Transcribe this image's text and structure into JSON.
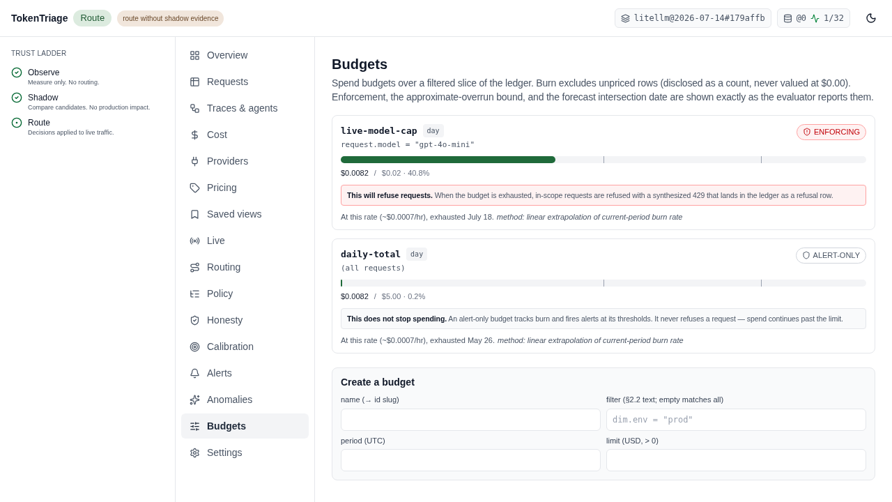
{
  "header": {
    "brand": "TokenTriage",
    "mode_badge": "Route",
    "warning_badge": "route without shadow evidence",
    "snapshot": "litellm@2026-07-14#179affb",
    "db_count": "@0",
    "activity": "1/32"
  },
  "trust_ladder": {
    "title": "TRUST LADDER",
    "steps": [
      {
        "name": "Observe",
        "description": "Measure only. No routing.",
        "kind": "done"
      },
      {
        "name": "Shadow",
        "description": "Compare candidates. No production impact.",
        "kind": "done"
      },
      {
        "name": "Route",
        "description": "Decisions applied to live traffic.",
        "kind": "current"
      }
    ]
  },
  "nav": [
    {
      "label": "Overview",
      "selected": false
    },
    {
      "label": "Requests",
      "selected": false
    },
    {
      "label": "Traces & agents",
      "selected": false
    },
    {
      "label": "Cost",
      "selected": false
    },
    {
      "label": "Providers",
      "selected": false
    },
    {
      "label": "Pricing",
      "selected": false
    },
    {
      "label": "Saved views",
      "selected": false
    },
    {
      "label": "Live",
      "selected": false
    },
    {
      "label": "Routing",
      "selected": false
    },
    {
      "label": "Policy",
      "selected": false
    },
    {
      "label": "Honesty",
      "selected": false
    },
    {
      "label": "Calibration",
      "selected": false
    },
    {
      "label": "Alerts",
      "selected": false
    },
    {
      "label": "Anomalies",
      "selected": false
    },
    {
      "label": "Budgets",
      "selected": true
    },
    {
      "label": "Settings",
      "selected": false
    }
  ],
  "page": {
    "title": "Budgets",
    "description": "Spend budgets over a filtered slice of the ledger. Burn excludes unpriced rows (disclosed as a count, never valued at $0.00). Enforcement, the approximate-overrun bound, and the forecast intersection date are shown exactly as the evaluator reports them."
  },
  "budgets": [
    {
      "name": "live-model-cap",
      "period": "day",
      "filter": "request.model = \"gpt-4o-mini\"",
      "kind": "enforcing",
      "status": "ENFORCING",
      "level": 0.408,
      "spent": "$0.0082",
      "separator": "/",
      "limit": "$0.02 · 40.8%",
      "notice": "**This will refuse requests.** When the budget is exhausted, in-scope requests are refused with a synthesized 429 that lands in the ledger as a refusal row.",
      "forecast": "At this rate (~$0.0007/hr), exhausted July 18.",
      "method": "method: linear extrapolation of current-period burn rate"
    },
    {
      "name": "daily-total",
      "period": "day",
      "filter": "(all requests)",
      "kind": "alert_only",
      "status": "ALERT-ONLY",
      "level": 0.002,
      "spent": "$0.0082",
      "separator": "/",
      "limit": "$5.00 · 0.2%",
      "notice": "**This does not stop spending.** An alert-only budget tracks burn and fires alerts at its thresholds. It never refuses a request — spend continues past the limit.",
      "forecast": "At this rate (~$0.0007/hr), exhausted May 26.",
      "method": "method: linear extrapolation of current-period burn rate"
    }
  ],
  "create_form": {
    "title": "Create a budget",
    "fields": [
      {
        "label": "name (→ id slug)"
      },
      {
        "label": "filter (§2.2 text; empty matches all)",
        "placeholder": "dim.env = \"prod\""
      },
      {
        "label": "period (UTC)"
      },
      {
        "label": "limit (USD, > 0)"
      }
    ]
  }
}
